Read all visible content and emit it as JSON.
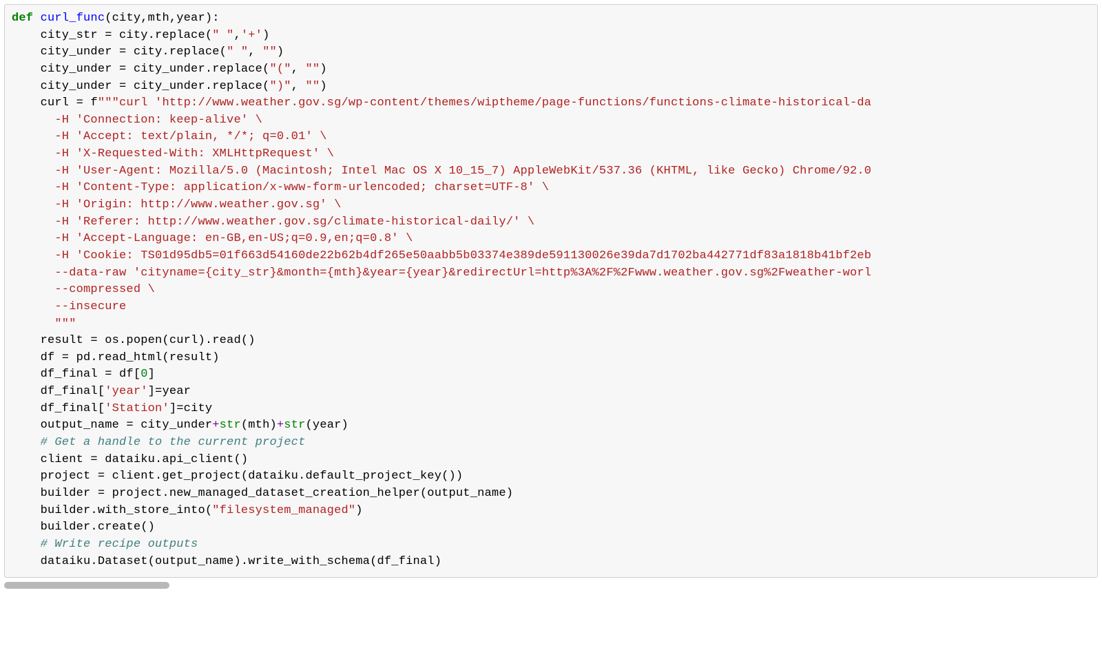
{
  "code": {
    "l0": {
      "a": "def ",
      "b": "curl_func",
      "c": "(city,mth,year):"
    },
    "l1": {
      "a": "    city_str = city.replace(",
      "s1": "\" \"",
      "b": ",",
      "s2": "'+'",
      "c": ")"
    },
    "l2": {
      "a": "    city_under = city.replace(",
      "s1": "\" \"",
      "b": ", ",
      "s2": "\"\"",
      "c": ")"
    },
    "l3": {
      "a": "    city_under = city_under.replace(",
      "s1": "\"(\"",
      "b": ", ",
      "s2": "\"\"",
      "c": ")"
    },
    "l4": {
      "a": "    city_under = city_under.replace(",
      "s1": "\")\"",
      "b": ", ",
      "s2": "\"\"",
      "c": ")"
    },
    "l5": {
      "a": "    curl = f",
      "s": "\"\"\"curl 'http://www.weather.gov.sg/wp-content/themes/wiptheme/page-functions/functions-climate-historical-da"
    },
    "l6": {
      "s": "      -H 'Connection: keep-alive' \\"
    },
    "l7": {
      "s": "      -H 'Accept: text/plain, */*; q=0.01' \\"
    },
    "l8": {
      "s": "      -H 'X-Requested-With: XMLHttpRequest' \\"
    },
    "l9": {
      "s": "      -H 'User-Agent: Mozilla/5.0 (Macintosh; Intel Mac OS X 10_15_7) AppleWebKit/537.36 (KHTML, like Gecko) Chrome/92.0"
    },
    "l10": {
      "s": "      -H 'Content-Type: application/x-www-form-urlencoded; charset=UTF-8' \\"
    },
    "l11": {
      "s": "      -H 'Origin: http://www.weather.gov.sg' \\"
    },
    "l12": {
      "s": "      -H 'Referer: http://www.weather.gov.sg/climate-historical-daily/' \\"
    },
    "l13": {
      "s": "      -H 'Accept-Language: en-GB,en-US;q=0.9,en;q=0.8' \\"
    },
    "l14": {
      "s": "      -H 'Cookie: TS01d95db5=01f663d54160de22b62b4df265e50aabb5b03374e389de591130026e39da7d1702ba442771df83a1818b41bf2eb"
    },
    "l15": {
      "s": "      --data-raw 'cityname={city_str}&month={mth}&year={year}&redirectUrl=http%3A%2F%2Fwww.weather.gov.sg%2Fweather-worl"
    },
    "l16": {
      "s": "      --compressed \\"
    },
    "l17": {
      "s": "      --insecure"
    },
    "l18": {
      "s": "      \"\"\""
    },
    "l19": {
      "a": "    result = os.popen(curl).read()"
    },
    "l20": {
      "a": "    df = pd.read_html(result)"
    },
    "l21": {
      "a": "    df_final = df[",
      "n": "0",
      "b": "]"
    },
    "l22": {
      "a": "    df_final[",
      "s": "'year'",
      "b": "]=year"
    },
    "l23": {
      "a": "    df_final[",
      "s": "'Station'",
      "b": "]=city"
    },
    "l24": {
      "a": "    output_name = city_under",
      "p1": "+",
      "b1": "str",
      "c1": "(mth)",
      "p2": "+",
      "b2": "str",
      "c2": "(year)"
    },
    "l25": {
      "c": "    # Get a handle to the current project"
    },
    "l26": {
      "a": "    client = dataiku.api_client()"
    },
    "l27": {
      "a": "    project = client.get_project(dataiku.default_project_key())"
    },
    "l28": {
      "a": "    builder = project.new_managed_dataset_creation_helper(output_name)"
    },
    "l29": {
      "a": "    builder.with_store_into(",
      "s": "\"filesystem_managed\"",
      "b": ")"
    },
    "l30": {
      "a": "    builder.create()"
    },
    "l31": {
      "c": "    # Write recipe outputs"
    },
    "l32": {
      "a": "    dataiku.Dataset(output_name).write_with_schema(df_final)"
    }
  }
}
